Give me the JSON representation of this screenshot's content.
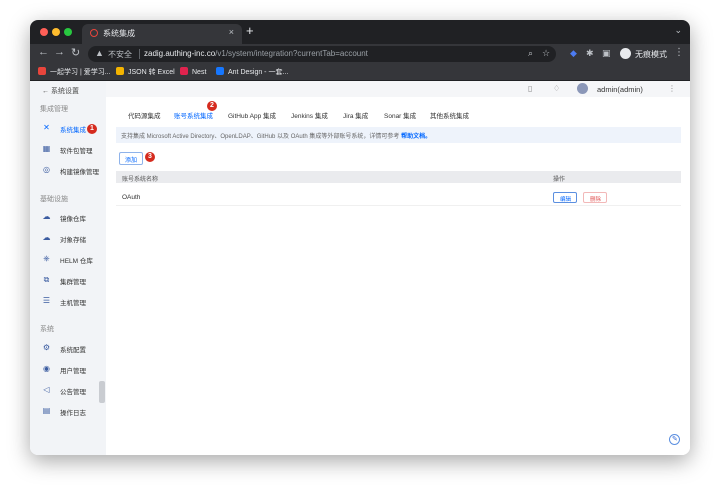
{
  "browser": {
    "tab_title": "系统集成",
    "tab_close": "×",
    "new_tab": "+",
    "omnibox": {
      "insecure_label": "不安全",
      "url_host": "zadig.authing-inc.co",
      "url_path": "/v1/system/integration?currentTab=account"
    },
    "profile_label": "无痕模式",
    "bookmarks": [
      {
        "label": "一起学习 | 爱学习...",
        "color": "#e8453c"
      },
      {
        "label": "JSON 转 Excel",
        "color": "#f4b400"
      },
      {
        "label": "Nest",
        "color": "#e0234e"
      },
      {
        "label": "Ant Design - 一套...",
        "color": "#1677ff"
      }
    ]
  },
  "sidebar": {
    "back_label": "系统设置",
    "groups": [
      {
        "title": "集成管理",
        "items": [
          {
            "label": "系统集成",
            "icon": "integration-icon",
            "active": true
          },
          {
            "label": "软件包管理",
            "icon": "package-icon"
          },
          {
            "label": "构建镜像管理",
            "icon": "build-image-icon"
          }
        ]
      },
      {
        "title": "基础设施",
        "items": [
          {
            "label": "镜像仓库",
            "icon": "registry-icon"
          },
          {
            "label": "对象存储",
            "icon": "cloud-storage-icon"
          },
          {
            "label": "HELM 仓库",
            "icon": "helm-icon"
          },
          {
            "label": "集群管理",
            "icon": "cluster-icon"
          },
          {
            "label": "主机管理",
            "icon": "host-icon"
          }
        ]
      },
      {
        "title": "系统",
        "items": [
          {
            "label": "系统配置",
            "icon": "system-config-icon"
          },
          {
            "label": "用户管理",
            "icon": "user-icon"
          },
          {
            "label": "公告管理",
            "icon": "announcement-icon"
          },
          {
            "label": "操作日志",
            "icon": "log-icon"
          }
        ]
      }
    ]
  },
  "header": {
    "user_name": "admin(admin)"
  },
  "integration_tabs": [
    {
      "label": "代码源集成"
    },
    {
      "label": "账号系统集成",
      "active": true
    },
    {
      "label": "GitHub App 集成"
    },
    {
      "label": "Jenkins 集成"
    },
    {
      "label": "Jira 集成"
    },
    {
      "label": "Sonar 集成"
    },
    {
      "label": "其他系统集成"
    }
  ],
  "notice": {
    "text": "支持集成 Microsoft Active Directory、OpenLDAP、GitHub 以及 OAuth 集成等外部账号系统，详情可参考",
    "link_text": "帮助文档。"
  },
  "add_button_label": "添加",
  "table": {
    "columns": [
      "账号系统名称",
      "操作"
    ],
    "rows": [
      {
        "name": "OAuth",
        "edit_label": "编辑",
        "delete_label": "删除"
      }
    ]
  },
  "annotations": [
    "1",
    "2",
    "3"
  ]
}
